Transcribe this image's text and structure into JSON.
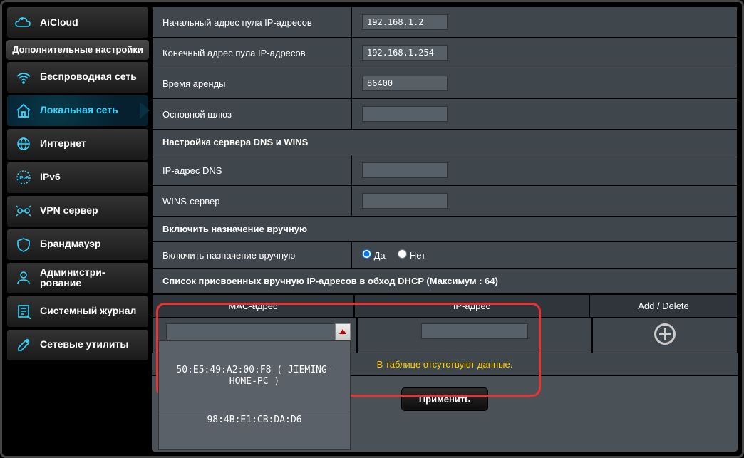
{
  "sidebar": {
    "aicloud": "AiCloud",
    "section_header": "Дополнительные настройки",
    "items": [
      {
        "label": "Беспроводная сеть"
      },
      {
        "label": "Локальная сеть"
      },
      {
        "label": "Интернет"
      },
      {
        "label": "IPv6"
      },
      {
        "label": "VPN сервер"
      },
      {
        "label": "Брандмауэр"
      },
      {
        "label": "Администри-\nрование"
      },
      {
        "label": "Системный журнал"
      },
      {
        "label": "Сетевые утилиты"
      }
    ]
  },
  "form": {
    "pool_start_label": "Начальный адрес пула IP-адресов",
    "pool_start_value": "192.168.1.2",
    "pool_end_label": "Конечный адрес пула IP-адресов",
    "pool_end_value": "192.168.1.254",
    "lease_label": "Время аренды",
    "lease_value": "86400",
    "gateway_label": "Основной шлюз",
    "gateway_value": ""
  },
  "dns_section": {
    "title": "Настройка сервера DNS и WINS",
    "dns_label": "IP-адрес DNS",
    "dns_value": "",
    "wins_label": "WINS-сервер",
    "wins_value": ""
  },
  "manual_section": {
    "title": "Включить назначение вручную",
    "toggle_label": "Включить назначение вручную",
    "yes": "Да",
    "no": "Нет"
  },
  "list": {
    "title": "Список присвоенных вручную IP-адресов в обход DHCP (Максимум : 64)",
    "col_mac": "MAC-адрес",
    "col_ip": "IP-адрес",
    "col_add": "Add / Delete",
    "no_data": "В таблице отсутствуют данные.",
    "mac_value": "",
    "mac_options": [
      "50:E5:49:A2:00:F8 ( JIEMING-HOME-PC )",
      "98:4B:E1:CB:DA:D6"
    ]
  },
  "buttons": {
    "apply": "Применить"
  }
}
